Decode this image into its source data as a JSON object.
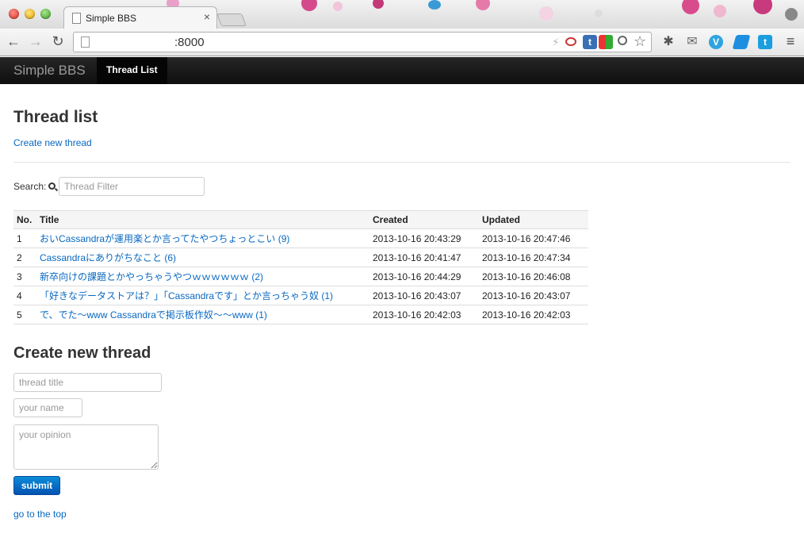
{
  "browser": {
    "tab_title": "Simple BBS",
    "tab_close": "×",
    "url": ":8000",
    "nav": {
      "back": "←",
      "forward": "→",
      "reload": "↻"
    },
    "menu": "≡"
  },
  "navbar": {
    "brand": "Simple BBS",
    "active_item": "Thread List"
  },
  "page": {
    "heading": "Thread list",
    "create_link": "Create new thread",
    "search": {
      "label": "Search:",
      "placeholder": "Thread Filter"
    },
    "table": {
      "headers": [
        "No.",
        "Title",
        "Created",
        "Updated"
      ],
      "rows": [
        {
          "no": "1",
          "title": "おいCassandraが運用楽とか言ってたやつちょっとこい (9)",
          "created": "2013-10-16 20:43:29",
          "updated": "2013-10-16 20:47:46"
        },
        {
          "no": "2",
          "title": "Cassandraにありがちなこと (6)",
          "created": "2013-10-16 20:41:47",
          "updated": "2013-10-16 20:47:34"
        },
        {
          "no": "3",
          "title": "新卒向けの課題とかやっちゃうやつｗｗｗｗｗｗ (2)",
          "created": "2013-10-16 20:44:29",
          "updated": "2013-10-16 20:46:08"
        },
        {
          "no": "4",
          "title": "「好きなデータストアは？」「Cassandraです」とか言っちゃう奴 (1)",
          "created": "2013-10-16 20:43:07",
          "updated": "2013-10-16 20:43:07"
        },
        {
          "no": "5",
          "title": "で、でた〜www Cassandraで掲示板作奴〜〜www (1)",
          "created": "2013-10-16 20:42:03",
          "updated": "2013-10-16 20:42:03"
        }
      ]
    },
    "form": {
      "heading": "Create new thread",
      "title_placeholder": "thread title",
      "name_placeholder": "your name",
      "opinion_placeholder": "your opinion",
      "submit_label": "submit"
    },
    "top_link": "go to the top"
  }
}
